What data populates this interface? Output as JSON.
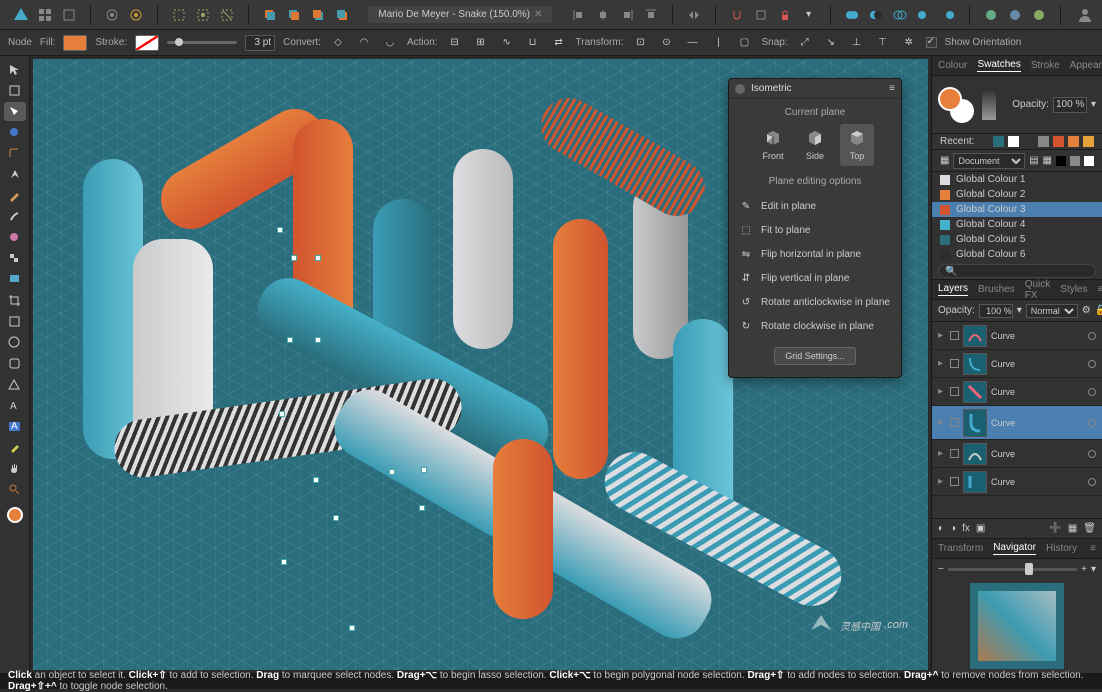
{
  "document": {
    "title": "Mario De Meyer - Snake (150.0%)"
  },
  "contextBar": {
    "nodeLabel": "Node",
    "fillLabel": "Fill:",
    "strokeLabel": "Stroke:",
    "strokeWidth": "3 pt",
    "convertLabel": "Convert:",
    "actionLabel": "Action:",
    "transformLabel": "Transform:",
    "snapLabel": "Snap:",
    "showOrientation": "Show Orientation"
  },
  "isometric": {
    "title": "Isometric",
    "currentPlane": "Current plane",
    "planes": {
      "front": "Front",
      "side": "Side",
      "top": "Top"
    },
    "editOptions": "Plane editing options",
    "items": {
      "editInPlane": "Edit in plane",
      "fitToPlane": "Fit to plane",
      "flipH": "Flip horizontal in plane",
      "flipV": "Flip vertical in plane",
      "rotACW": "Rotate anticlockwise in plane",
      "rotCW": "Rotate clockwise in plane"
    },
    "gridSettings": "Grid Settings..."
  },
  "rightPanel": {
    "colorTabs": {
      "colour": "Colour",
      "swatches": "Swatches",
      "stroke": "Stroke",
      "appearance": "Appearance"
    },
    "opacityLabel": "Opacity:",
    "opacityValue": "100 %",
    "recentLabel": "Recent:",
    "docSelect": "Document",
    "globalColours": [
      {
        "name": "Global Colour 1",
        "hex": "#dcdde0"
      },
      {
        "name": "Global Colour 2",
        "hex": "#e67e3c"
      },
      {
        "name": "Global Colour 3",
        "hex": "#d1542e"
      },
      {
        "name": "Global Colour 4",
        "hex": "#45b0c9"
      },
      {
        "name": "Global Colour 5",
        "hex": "#2a6e7d"
      },
      {
        "name": "Global Colour 6",
        "hex": "#2d2d2d"
      }
    ],
    "layerTabs": {
      "layers": "Layers",
      "brushes": "Brushes",
      "quickfx": "Quick FX",
      "styles": "Styles"
    },
    "layerOpacityLabel": "Opacity:",
    "layerOpacity": "100 %",
    "blendMode": "Normal",
    "layerName": "Curve",
    "navTabs": {
      "transform": "Transform",
      "navigator": "Navigator",
      "history": "History"
    }
  },
  "statusBar": {
    "s1a": "Click",
    "s1b": " an object to select it. ",
    "s2a": "Click+⇧",
    "s2b": " to add to selection. ",
    "s3a": "Drag",
    "s3b": " to marquee select nodes. ",
    "s4a": "Drag+⌥",
    "s4b": " to begin lasso selection. ",
    "s5a": "Click+⌥",
    "s5b": " to begin polygonal node selection. ",
    "s6a": "Drag+⇧",
    "s6b": " to add nodes to selection. ",
    "s7a": "Drag+^",
    "s7b": " to remove nodes from selection. ",
    "s8a": "Drag+⇧+^",
    "s8b": " to toggle node selection."
  },
  "watermark": {
    "text": "灵感中国",
    "suffix": ".com"
  }
}
